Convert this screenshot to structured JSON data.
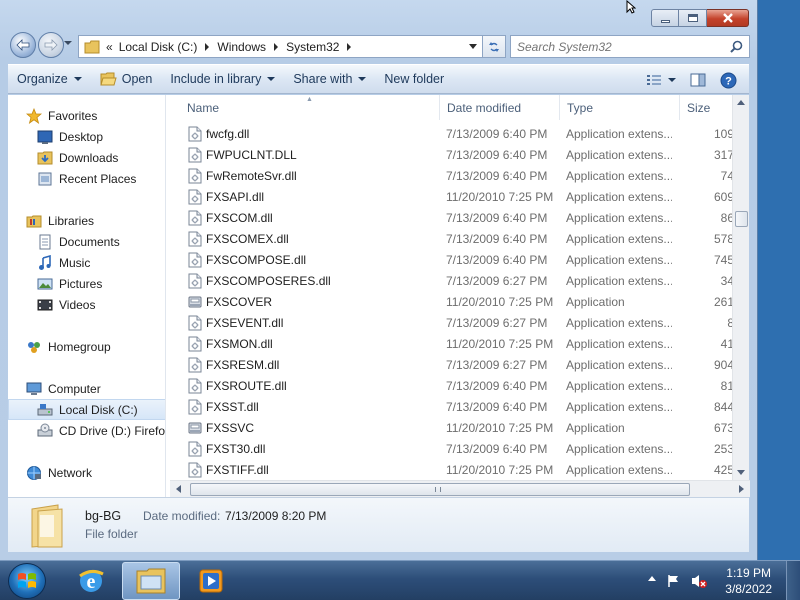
{
  "window": {
    "caption_buttons": [
      "minimize",
      "maximize",
      "close"
    ]
  },
  "address": {
    "overflow": "«",
    "crumbs": [
      "Local Disk (C:)",
      "Windows",
      "System32"
    ]
  },
  "search": {
    "placeholder": "Search System32"
  },
  "toolbar": {
    "organize": "Organize",
    "open": "Open",
    "include_in_library": "Include in library",
    "share_with": "Share with",
    "new_folder": "New folder"
  },
  "nav": {
    "favorites": "Favorites",
    "desktop": "Desktop",
    "downloads": "Downloads",
    "recent_places": "Recent Places",
    "libraries": "Libraries",
    "documents": "Documents",
    "music": "Music",
    "pictures": "Pictures",
    "videos": "Videos",
    "homegroup": "Homegroup",
    "computer": "Computer",
    "local_disk": "Local Disk (C:)",
    "cd_drive": "CD Drive (D:) Firefox",
    "network": "Network"
  },
  "columns": {
    "name": "Name",
    "date": "Date modified",
    "type": "Type",
    "size": "Size"
  },
  "files": [
    {
      "name": "fwcfg.dll",
      "date": "7/13/2009 6:40 PM",
      "type": "Application extens...",
      "size": "109",
      "icon": "dll-icon"
    },
    {
      "name": "FWPUCLNT.DLL",
      "date": "7/13/2009 6:40 PM",
      "type": "Application extens...",
      "size": "317",
      "icon": "dll-icon"
    },
    {
      "name": "FwRemoteSvr.dll",
      "date": "7/13/2009 6:40 PM",
      "type": "Application extens...",
      "size": "74",
      "icon": "dll-icon"
    },
    {
      "name": "FXSAPI.dll",
      "date": "11/20/2010 7:25 PM",
      "type": "Application extens...",
      "size": "609",
      "icon": "dll-icon"
    },
    {
      "name": "FXSCOM.dll",
      "date": "7/13/2009 6:40 PM",
      "type": "Application extens...",
      "size": "86",
      "icon": "dll-icon"
    },
    {
      "name": "FXSCOMEX.dll",
      "date": "7/13/2009 6:40 PM",
      "type": "Application extens...",
      "size": "578",
      "icon": "dll-icon"
    },
    {
      "name": "FXSCOMPOSE.dll",
      "date": "7/13/2009 6:40 PM",
      "type": "Application extens...",
      "size": "745",
      "icon": "dll-icon"
    },
    {
      "name": "FXSCOMPOSERES.dll",
      "date": "7/13/2009 6:27 PM",
      "type": "Application extens...",
      "size": "34",
      "icon": "dll-icon"
    },
    {
      "name": "FXSCOVER",
      "date": "11/20/2010 7:25 PM",
      "type": "Application",
      "size": "261",
      "icon": "fax-cover-app-icon"
    },
    {
      "name": "FXSEVENT.dll",
      "date": "7/13/2009 6:27 PM",
      "type": "Application extens...",
      "size": "8",
      "icon": "dll-icon"
    },
    {
      "name": "FXSMON.dll",
      "date": "11/20/2010 7:25 PM",
      "type": "Application extens...",
      "size": "41",
      "icon": "dll-icon"
    },
    {
      "name": "FXSRESM.dll",
      "date": "7/13/2009 6:27 PM",
      "type": "Application extens...",
      "size": "904",
      "icon": "dll-icon"
    },
    {
      "name": "FXSROUTE.dll",
      "date": "7/13/2009 6:40 PM",
      "type": "Application extens...",
      "size": "81",
      "icon": "dll-icon"
    },
    {
      "name": "FXSST.dll",
      "date": "7/13/2009 6:40 PM",
      "type": "Application extens...",
      "size": "844",
      "icon": "dll-icon"
    },
    {
      "name": "FXSSVC",
      "date": "11/20/2010 7:25 PM",
      "type": "Application",
      "size": "673",
      "icon": "fax-service-app-icon"
    },
    {
      "name": "FXST30.dll",
      "date": "7/13/2009 6:40 PM",
      "type": "Application extens...",
      "size": "253",
      "icon": "dll-icon"
    },
    {
      "name": "FXSTIFF.dll",
      "date": "11/20/2010 7:25 PM",
      "type": "Application extens...",
      "size": "425",
      "icon": "dll-icon"
    }
  ],
  "details": {
    "name": "bg-BG",
    "date_label": "Date modified:",
    "date_value": "7/13/2009 8:20 PM",
    "kind": "File folder"
  },
  "taskbar": {
    "apps": [
      "internet-explorer-icon",
      "windows-explorer-icon",
      "media-player-icon"
    ],
    "time": "1:19 PM",
    "date": "3/8/2022"
  },
  "colors": {
    "accent": "#1e395b",
    "selection": "#d6e6f8",
    "taskbar": "#2d4e79"
  }
}
